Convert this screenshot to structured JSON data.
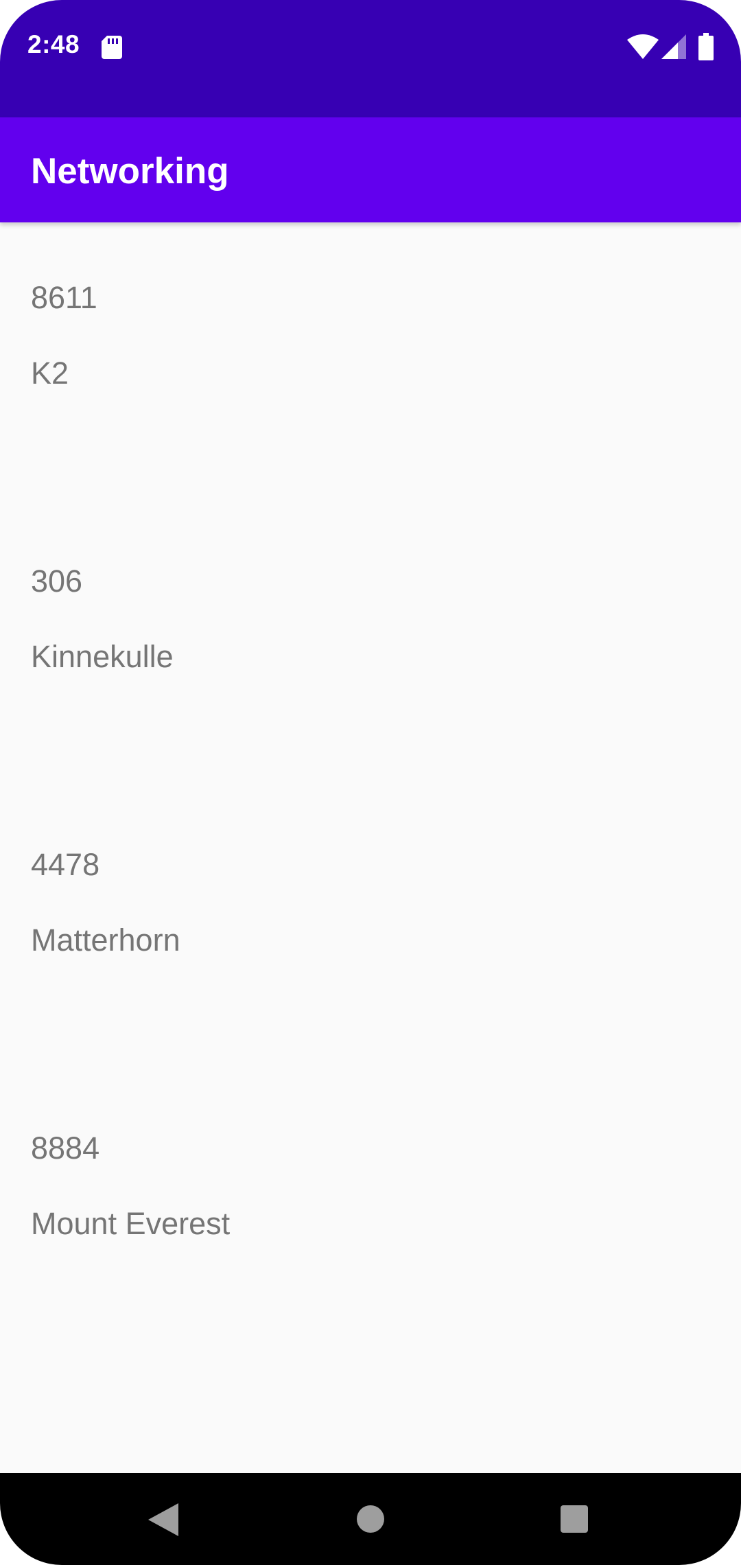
{
  "status_bar": {
    "time": "2:48",
    "icons": [
      "sd-card-icon",
      "wifi-icon",
      "signal-icon",
      "battery-icon"
    ]
  },
  "app_bar": {
    "title": "Networking"
  },
  "list": {
    "items": [
      {
        "height": "8611",
        "name": "K2"
      },
      {
        "height": "306",
        "name": "Kinnekulle"
      },
      {
        "height": "4478",
        "name": "Matterhorn"
      },
      {
        "height": "8884",
        "name": "Mount Everest"
      }
    ]
  },
  "nav_bar": {
    "buttons": [
      "back-icon",
      "home-icon",
      "recents-icon"
    ]
  },
  "colors": {
    "status_bar": "#3700b3",
    "app_bar": "#6200ee",
    "background": "#fafafa",
    "text_secondary": "#757575",
    "nav_bar": "#000000"
  }
}
